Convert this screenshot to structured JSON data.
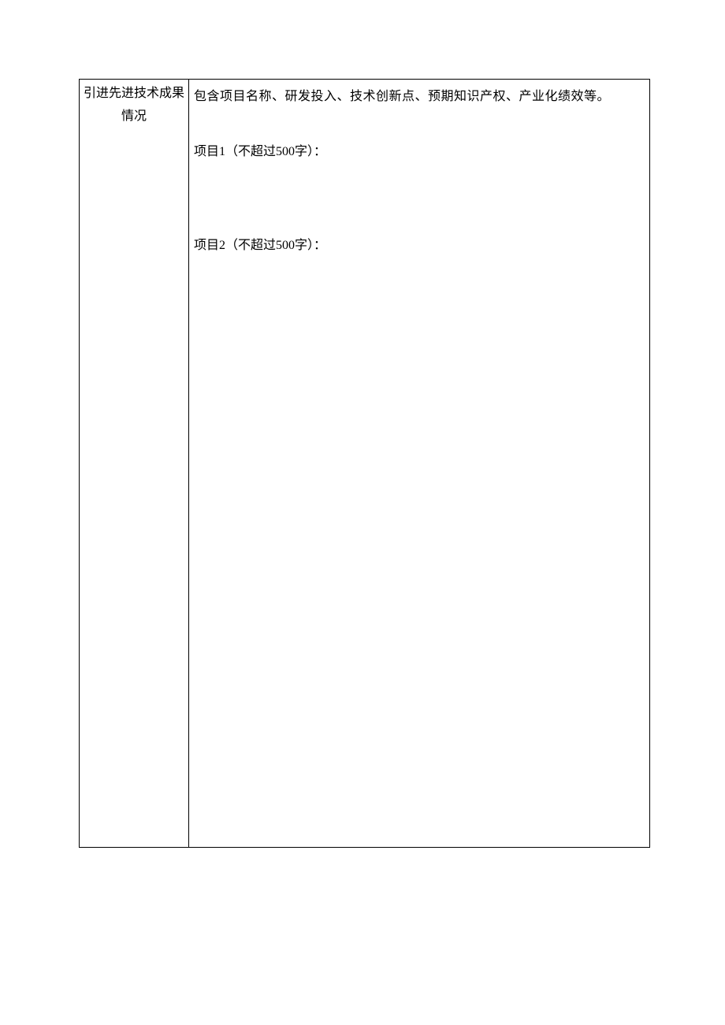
{
  "form": {
    "row_label": "引进先进技术成果情况",
    "description": "包含项目名称、研发投入、技术创新点、预期知识产权、产业化绩效等。",
    "projects": [
      {
        "prefix": "项目",
        "num": "1",
        "limit_open": "（不超过",
        "limit_num": "500",
        "limit_close": "字）："
      },
      {
        "prefix": "项目",
        "num": "2",
        "limit_open": "（不超过",
        "limit_num": "500",
        "limit_close": "字）："
      }
    ]
  }
}
